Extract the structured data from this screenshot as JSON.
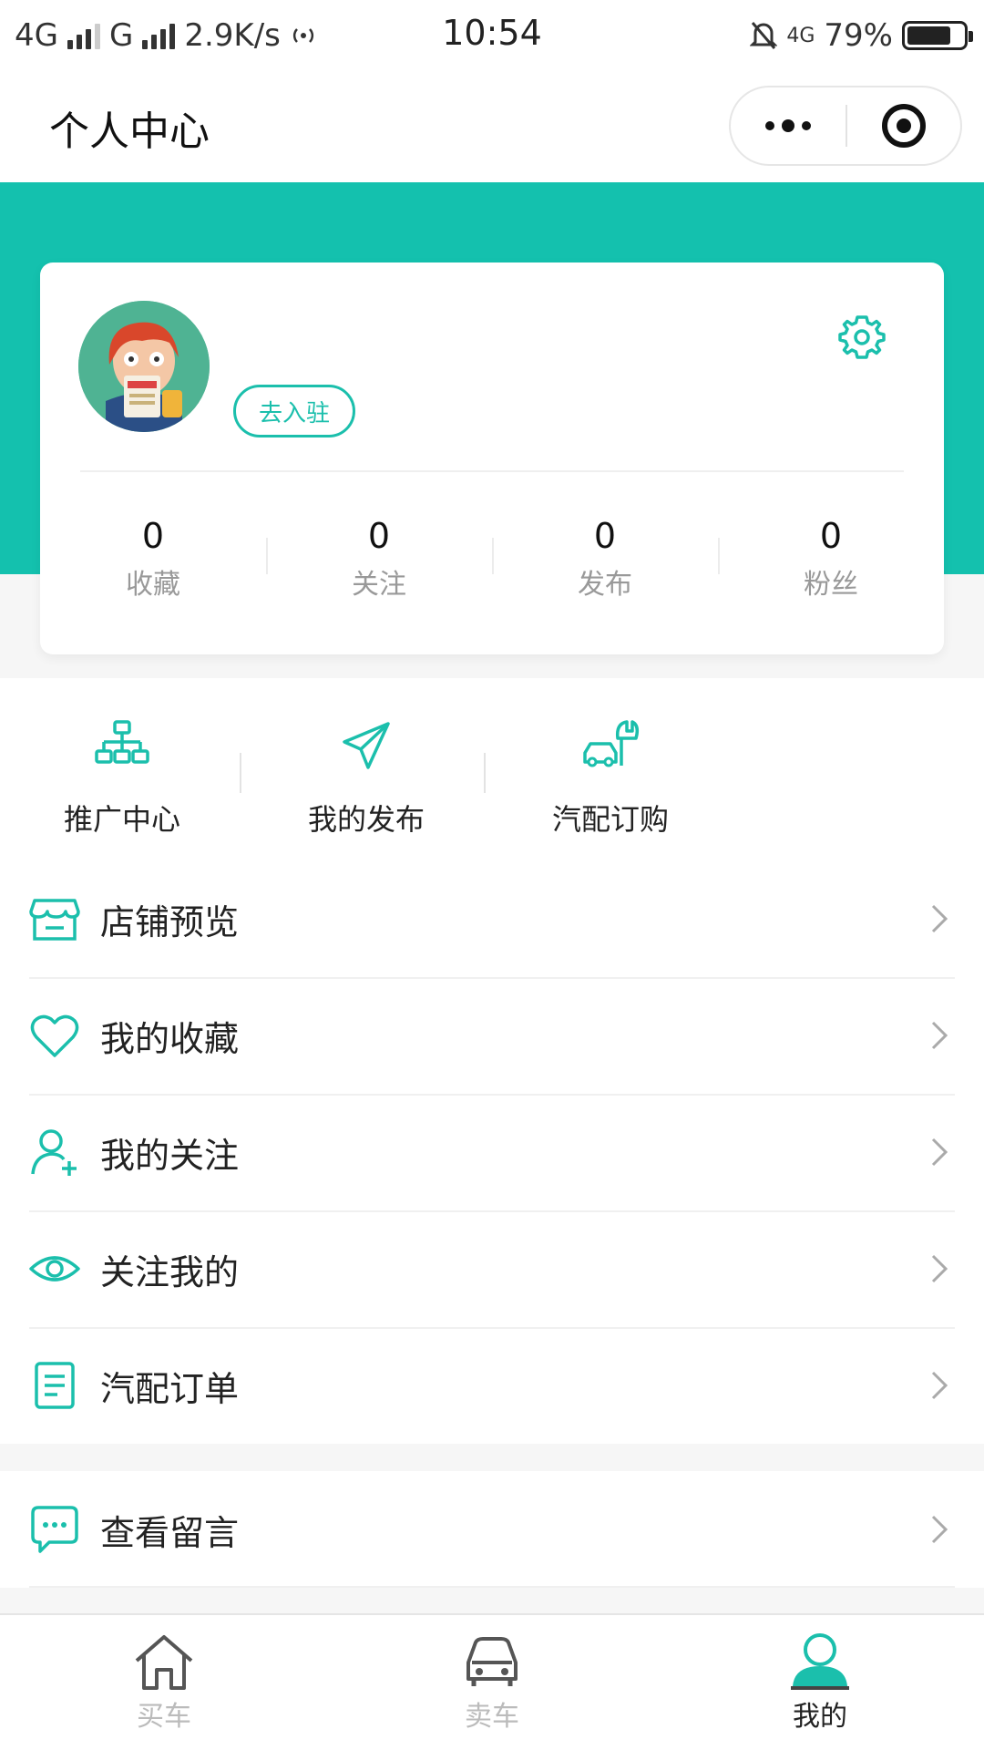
{
  "status_bar": {
    "network_1": "4G",
    "network_2": "G",
    "speed": "2.9K/s",
    "time": "10:54",
    "network_3": "4G",
    "battery": "79%",
    "battery_level": 0.79
  },
  "nav": {
    "title": "个人中心"
  },
  "profile": {
    "join_label": "去入驻",
    "stats": [
      {
        "value": "0",
        "label": "收藏"
      },
      {
        "value": "0",
        "label": "关注"
      },
      {
        "value": "0",
        "label": "发布"
      },
      {
        "value": "0",
        "label": "粉丝"
      }
    ]
  },
  "tools": [
    {
      "label": "推广中心",
      "icon": "org-chart-icon"
    },
    {
      "label": "我的发布",
      "icon": "paper-plane-icon"
    },
    {
      "label": "汽配订购",
      "icon": "car-repair-icon"
    }
  ],
  "menu": [
    {
      "label": "店铺预览",
      "icon": "store-icon"
    },
    {
      "label": "我的收藏",
      "icon": "heart-icon"
    },
    {
      "label": "我的关注",
      "icon": "user-add-icon"
    },
    {
      "label": "关注我的",
      "icon": "eye-icon"
    },
    {
      "label": "汽配订单",
      "icon": "document-icon"
    }
  ],
  "menu2": [
    {
      "label": "查看留言",
      "icon": "chat-icon"
    }
  ],
  "tab_bar": {
    "items": [
      {
        "label": "买车",
        "icon": "home-icon"
      },
      {
        "label": "卖车",
        "icon": "car-icon"
      },
      {
        "label": "我的",
        "icon": "user-icon"
      }
    ],
    "active": 2
  },
  "colors": {
    "accent": "#14c1ae",
    "tab_active": "#222222",
    "tab_inactive": "#bbbbbb"
  }
}
